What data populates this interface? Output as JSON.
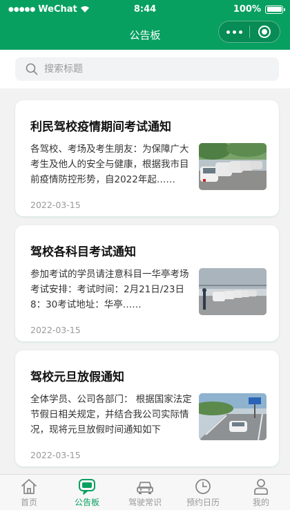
{
  "status_bar": {
    "signal": "●●●●●",
    "carrier": "WeChat",
    "time": "8:44",
    "battery": "100%"
  },
  "header": {
    "title": "公告板"
  },
  "search": {
    "placeholder": "搜索标题"
  },
  "notices": [
    {
      "title": "利民驾校疫情期间考试通知",
      "summary": "各驾校、考场及考生朋友：为保障广大考生及他人的安全与健康，根据我市目前疫情防控形势，自2022年起……",
      "date": "2022-03-15"
    },
    {
      "title": "驾校各科目考试通知",
      "summary": "参加考试的学员请注意科目一华亭考场考试安排：考试时间：2月21日/23日 8：30考试地址：华亭……",
      "date": "2022-03-15"
    },
    {
      "title": "驾校元旦放假通知",
      "summary": "全体学员、公司各部门： 根据国家法定节假日相关规定，并结合我公司实际情况，现将元旦放假时间通知如下",
      "date": "2022-03-15"
    }
  ],
  "tabbar": [
    {
      "label": "首页",
      "icon": "home-icon",
      "active": false
    },
    {
      "label": "公告板",
      "icon": "message-icon",
      "active": true
    },
    {
      "label": "驾驶常识",
      "icon": "car-icon",
      "active": false
    },
    {
      "label": "预约日历",
      "icon": "clock-icon",
      "active": false
    },
    {
      "label": "我的",
      "icon": "user-icon",
      "active": false
    }
  ],
  "colors": {
    "brand": "#07a060",
    "inactive": "#999999"
  }
}
